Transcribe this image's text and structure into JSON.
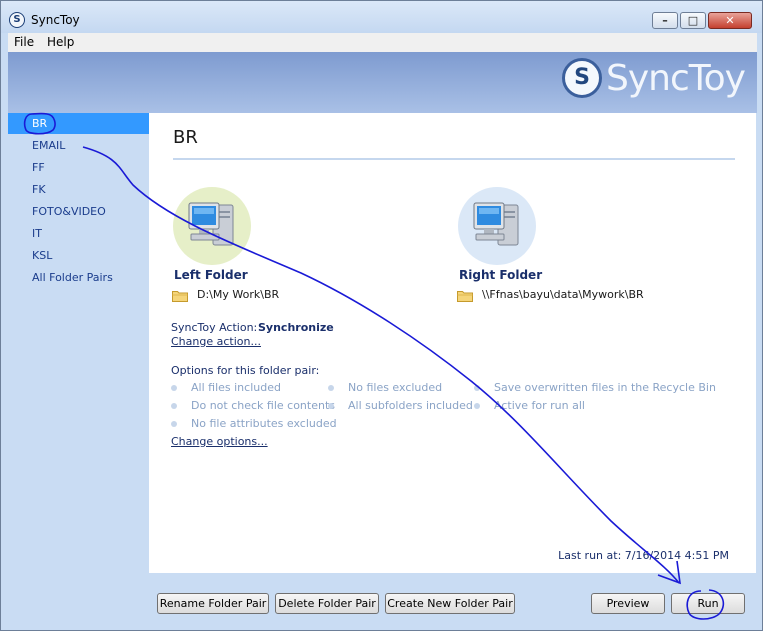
{
  "window": {
    "title": "SyncToy"
  },
  "menu": {
    "file": "File",
    "help": "Help"
  },
  "banner": {
    "logo_text": "SyncToy",
    "logo_icon": "synctoy-logo-icon"
  },
  "sidebar": {
    "items": [
      {
        "label": "BR",
        "selected": true
      },
      {
        "label": "EMAIL",
        "selected": false
      },
      {
        "label": "FF",
        "selected": false
      },
      {
        "label": "FK",
        "selected": false
      },
      {
        "label": "FOTO&VIDEO",
        "selected": false
      },
      {
        "label": "IT",
        "selected": false
      },
      {
        "label": "KSL",
        "selected": false
      },
      {
        "label": "All Folder Pairs",
        "selected": false
      }
    ]
  },
  "pair": {
    "name": "BR",
    "left_folder_label": "Left Folder",
    "left_folder_path": "D:\\My Work\\BR",
    "right_folder_label": "Right Folder",
    "right_folder_path": "\\\\Ffnas\\bayu\\data\\Mywork\\BR",
    "action_label": "SyncToy Action:",
    "action_value": "Synchronize",
    "change_action": "Change action...",
    "options_title": "Options for this folder pair:",
    "options": [
      "All files included",
      "No files excluded",
      "Save overwritten files in the Recycle Bin",
      "Do not check file contents",
      "All subfolders included",
      "Active for run all",
      "No file attributes excluded"
    ],
    "change_options": "Change options...",
    "last_run": "Last run at: 7/16/2014 4:51 PM"
  },
  "buttons": {
    "rename": "Rename Folder Pair",
    "delete": "Delete Folder Pair",
    "create": "Create New Folder Pair",
    "preview": "Preview",
    "run": "Run"
  },
  "colors": {
    "selection": "#3399ff",
    "sidebar_bg": "#c9dcf3",
    "banner_bg": "#8aa6d8",
    "annotation_ink": "#1a1ad6",
    "left_computer_halo": "#e6efc8",
    "right_computer_halo": "#dbe8f7"
  },
  "icons": {
    "folder": "folder-icon",
    "computer": "computer-icon"
  }
}
